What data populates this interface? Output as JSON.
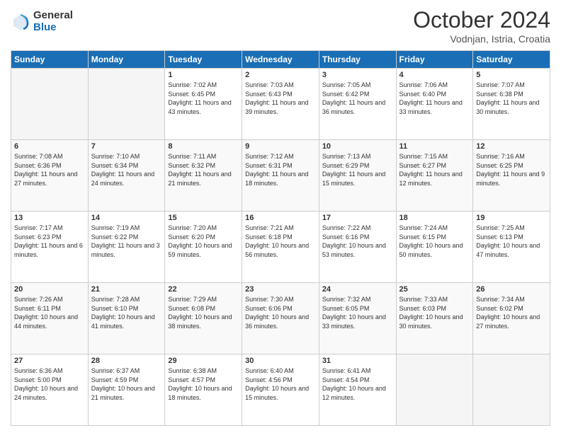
{
  "header": {
    "logo_general": "General",
    "logo_blue": "Blue",
    "title": "October 2024",
    "location": "Vodnjan, Istria, Croatia"
  },
  "days_of_week": [
    "Sunday",
    "Monday",
    "Tuesday",
    "Wednesday",
    "Thursday",
    "Friday",
    "Saturday"
  ],
  "weeks": [
    [
      {
        "day": "",
        "info": ""
      },
      {
        "day": "",
        "info": ""
      },
      {
        "day": "1",
        "info": "Sunrise: 7:02 AM\nSunset: 6:45 PM\nDaylight: 11 hours and 43 minutes."
      },
      {
        "day": "2",
        "info": "Sunrise: 7:03 AM\nSunset: 6:43 PM\nDaylight: 11 hours and 39 minutes."
      },
      {
        "day": "3",
        "info": "Sunrise: 7:05 AM\nSunset: 6:42 PM\nDaylight: 11 hours and 36 minutes."
      },
      {
        "day": "4",
        "info": "Sunrise: 7:06 AM\nSunset: 6:40 PM\nDaylight: 11 hours and 33 minutes."
      },
      {
        "day": "5",
        "info": "Sunrise: 7:07 AM\nSunset: 6:38 PM\nDaylight: 11 hours and 30 minutes."
      }
    ],
    [
      {
        "day": "6",
        "info": "Sunrise: 7:08 AM\nSunset: 6:36 PM\nDaylight: 11 hours and 27 minutes."
      },
      {
        "day": "7",
        "info": "Sunrise: 7:10 AM\nSunset: 6:34 PM\nDaylight: 11 hours and 24 minutes."
      },
      {
        "day": "8",
        "info": "Sunrise: 7:11 AM\nSunset: 6:32 PM\nDaylight: 11 hours and 21 minutes."
      },
      {
        "day": "9",
        "info": "Sunrise: 7:12 AM\nSunset: 6:31 PM\nDaylight: 11 hours and 18 minutes."
      },
      {
        "day": "10",
        "info": "Sunrise: 7:13 AM\nSunset: 6:29 PM\nDaylight: 11 hours and 15 minutes."
      },
      {
        "day": "11",
        "info": "Sunrise: 7:15 AM\nSunset: 6:27 PM\nDaylight: 11 hours and 12 minutes."
      },
      {
        "day": "12",
        "info": "Sunrise: 7:16 AM\nSunset: 6:25 PM\nDaylight: 11 hours and 9 minutes."
      }
    ],
    [
      {
        "day": "13",
        "info": "Sunrise: 7:17 AM\nSunset: 6:23 PM\nDaylight: 11 hours and 6 minutes."
      },
      {
        "day": "14",
        "info": "Sunrise: 7:19 AM\nSunset: 6:22 PM\nDaylight: 11 hours and 3 minutes."
      },
      {
        "day": "15",
        "info": "Sunrise: 7:20 AM\nSunset: 6:20 PM\nDaylight: 10 hours and 59 minutes."
      },
      {
        "day": "16",
        "info": "Sunrise: 7:21 AM\nSunset: 6:18 PM\nDaylight: 10 hours and 56 minutes."
      },
      {
        "day": "17",
        "info": "Sunrise: 7:22 AM\nSunset: 6:16 PM\nDaylight: 10 hours and 53 minutes."
      },
      {
        "day": "18",
        "info": "Sunrise: 7:24 AM\nSunset: 6:15 PM\nDaylight: 10 hours and 50 minutes."
      },
      {
        "day": "19",
        "info": "Sunrise: 7:25 AM\nSunset: 6:13 PM\nDaylight: 10 hours and 47 minutes."
      }
    ],
    [
      {
        "day": "20",
        "info": "Sunrise: 7:26 AM\nSunset: 6:11 PM\nDaylight: 10 hours and 44 minutes."
      },
      {
        "day": "21",
        "info": "Sunrise: 7:28 AM\nSunset: 6:10 PM\nDaylight: 10 hours and 41 minutes."
      },
      {
        "day": "22",
        "info": "Sunrise: 7:29 AM\nSunset: 6:08 PM\nDaylight: 10 hours and 38 minutes."
      },
      {
        "day": "23",
        "info": "Sunrise: 7:30 AM\nSunset: 6:06 PM\nDaylight: 10 hours and 36 minutes."
      },
      {
        "day": "24",
        "info": "Sunrise: 7:32 AM\nSunset: 6:05 PM\nDaylight: 10 hours and 33 minutes."
      },
      {
        "day": "25",
        "info": "Sunrise: 7:33 AM\nSunset: 6:03 PM\nDaylight: 10 hours and 30 minutes."
      },
      {
        "day": "26",
        "info": "Sunrise: 7:34 AM\nSunset: 6:02 PM\nDaylight: 10 hours and 27 minutes."
      }
    ],
    [
      {
        "day": "27",
        "info": "Sunrise: 6:36 AM\nSunset: 5:00 PM\nDaylight: 10 hours and 24 minutes."
      },
      {
        "day": "28",
        "info": "Sunrise: 6:37 AM\nSunset: 4:59 PM\nDaylight: 10 hours and 21 minutes."
      },
      {
        "day": "29",
        "info": "Sunrise: 6:38 AM\nSunset: 4:57 PM\nDaylight: 10 hours and 18 minutes."
      },
      {
        "day": "30",
        "info": "Sunrise: 6:40 AM\nSunset: 4:56 PM\nDaylight: 10 hours and 15 minutes."
      },
      {
        "day": "31",
        "info": "Sunrise: 6:41 AM\nSunset: 4:54 PM\nDaylight: 10 hours and 12 minutes."
      },
      {
        "day": "",
        "info": ""
      },
      {
        "day": "",
        "info": ""
      }
    ]
  ]
}
